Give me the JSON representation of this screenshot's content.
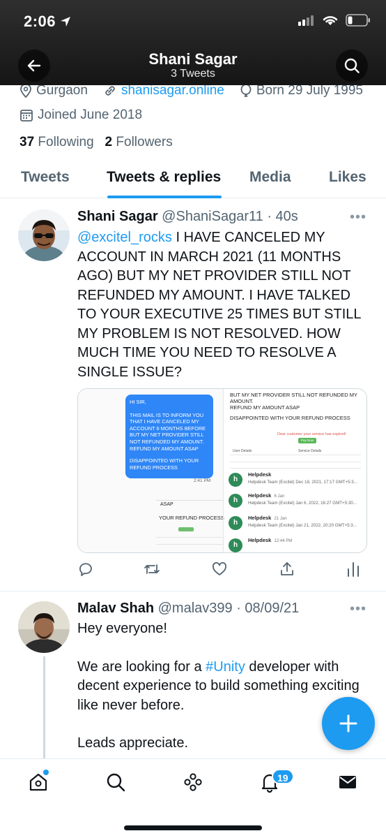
{
  "status": {
    "time": "2:06"
  },
  "header": {
    "title": "Shani Sagar",
    "subtitle": "3 Tweets"
  },
  "profile": {
    "location": "Gurgaon",
    "website": "shanisagar.online",
    "born": "Born 29 July 1995",
    "joined": "Joined June 2018",
    "following_count": "37",
    "following_label": "Following",
    "followers_count": "2",
    "followers_label": "Followers"
  },
  "tabs": [
    {
      "label": "Tweets"
    },
    {
      "label": "Tweets & replies"
    },
    {
      "label": "Media"
    },
    {
      "label": "Likes"
    }
  ],
  "tweets": [
    {
      "name": "Shani Sagar",
      "handle_time": "@ShaniSagar11 · 40s",
      "mention": "@excitel_rocks",
      "text": " I HAVE CANCELED MY ACCOUNT IN MARCH 2021 (11 MONTHS AGO) BUT MY NET PROVIDER STILL NOT REFUNDED MY AMOUNT. I HAVE TALKED TO YOUR EXECUTIVE 25 TIMES BUT STILL MY PROBLEM IS NOT RESOLVED. HOW MUCH TIME YOU NEED TO RESOLVE A SINGLE ISSUE?",
      "more": "•••",
      "image": {
        "chat_greeting": "HI SIR,",
        "chat_body": "THIS MAIL IS TO INFORM YOU THAT I HAVE CANCELED MY ACCOUNT 6 MONTHS BEFORE BUT MY NET PROVIDER STILL NOT REFUNDED MY AMOUNT. REFUND MY AMOUNT ASAP",
        "chat_footer": "DISAPPOINTED WITH YOUR REFUND PROCESS",
        "chat_time": "2:41 PM",
        "asap": "ASAP",
        "left_refund": "YOUR REFUND PROCESS",
        "right_head_1": "BUT MY NET PROVIDER STILL NOT REFUNDED MY AMOUNT.",
        "right_head_2": "REFUND MY AMOUNT ASAP",
        "right_head_3": "DISAPPOINTED WITH YOUR REFUND PROCESS",
        "expired_text": "Dear customer your service has expired!",
        "pay_btn": "Pay Now",
        "user_details": "User Details",
        "service_details": "Service Details",
        "mails": [
          {
            "title": "Helpdesk",
            "date": "",
            "sub": "Helpdesk Team (Excitel) Dec 18, 2021, 17:17 GMT+5:3..."
          },
          {
            "title": "Helpdesk",
            "date": "6 Jan",
            "sub": "Helpdesk Team (Excitel) Jan 6, 2022, 16:27 GMT+5:30..."
          },
          {
            "title": "Helpdesk",
            "date": "21 Jan",
            "sub": "Helpdesk Team (Excitel) Jan 21, 2022, 20:20 GMT+5:3..."
          },
          {
            "title": "Helpdesk",
            "date": "12:44 PM",
            "sub": ""
          }
        ]
      }
    },
    {
      "name": "Malav Shah",
      "handle_time": "@malav399 · 08/09/21",
      "more": "•••",
      "line1": "Hey everyone!",
      "line2_pre": "We are looking for a ",
      "hashtag": "#Unity",
      "line2_post": " developer with decent experience to build something exciting like never before.",
      "line3": "Leads appreciate."
    }
  ],
  "tabbar": {
    "notification_badge": "19"
  },
  "colors": {
    "accent": "#1d9bf0",
    "text": "#0f1419",
    "muted": "#536471"
  }
}
